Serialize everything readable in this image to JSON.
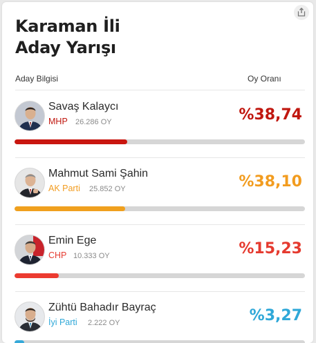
{
  "title": {
    "line1": "Karaman İli",
    "line2": "Aday Yarışı"
  },
  "share_icon": "share-icon",
  "columns": {
    "candidate": "Aday Bilgisi",
    "rate": "Oy Oranı"
  },
  "candidates": [
    {
      "name": "Savaş Kalaycı",
      "party": "MHP",
      "votes": "26.286 OY",
      "percent": "%38,74",
      "share": 0.3874,
      "color": "#c0170f",
      "bar_color": "#c9160f"
    },
    {
      "name": "Mahmut Sami Şahin",
      "party": "AK Parti",
      "votes": "25.852 OY",
      "percent": "%38,10",
      "share": 0.381,
      "color": "#f29c1f",
      "bar_color": "#f0a01e"
    },
    {
      "name": "Emin Ege",
      "party": "CHP",
      "votes": "10.333 OY",
      "percent": "%15,23",
      "share": 0.1523,
      "color": "#e53a2f",
      "bar_color": "#ec3b30"
    },
    {
      "name": "Zühtü Bahadır Bayraç",
      "party": "İyi Parti",
      "votes": "2.222 OY",
      "percent": "%3,27",
      "share": 0.0327,
      "color": "#2fa8d8",
      "bar_color": "#36a9d9"
    }
  ]
}
